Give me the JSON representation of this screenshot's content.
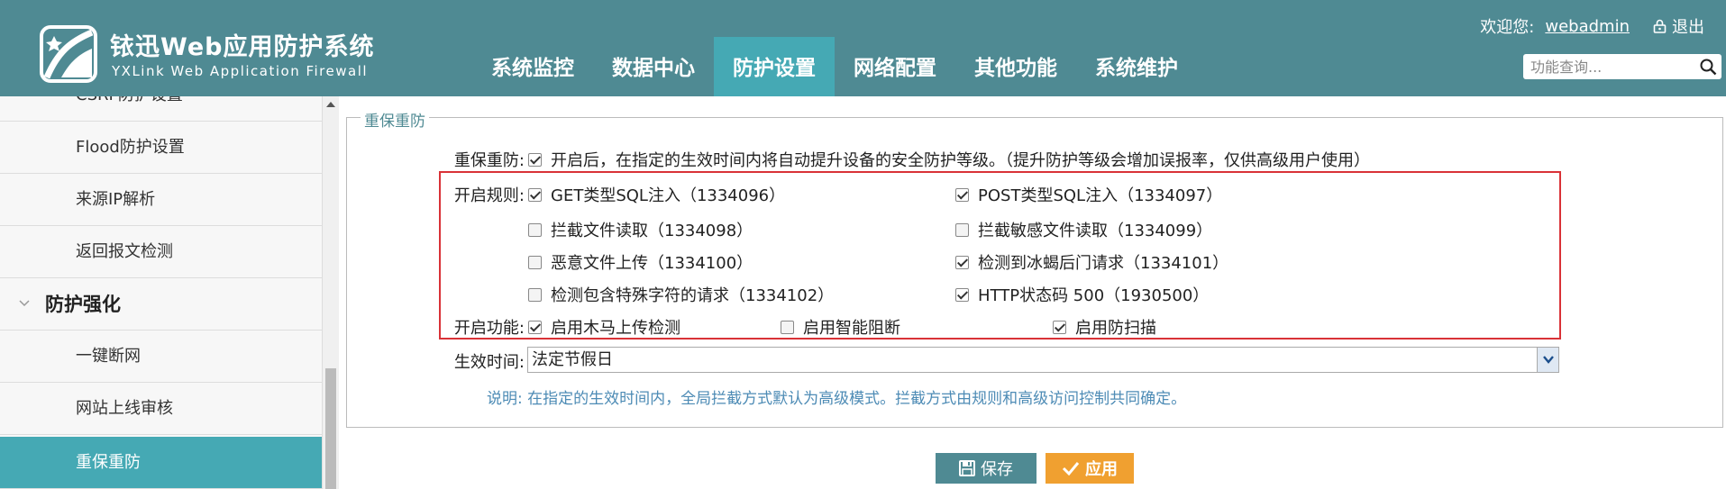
{
  "header": {
    "logo_cn": "铱迅Web应用防护系统",
    "logo_en": "YXLink Web Application Firewall",
    "welcome": "欢迎您:",
    "username": "webadmin",
    "logout": "退出",
    "search_placeholder": "功能查询...",
    "nav": [
      "系统监控",
      "数据中心",
      "防护设置",
      "网络配置",
      "其他功能",
      "系统维护"
    ],
    "active_nav": "防护设置"
  },
  "sidebar": {
    "items": [
      {
        "label": "CSRF防护设置"
      },
      {
        "label": "Flood防护设置"
      },
      {
        "label": "来源IP解析"
      },
      {
        "label": "返回报文检测"
      }
    ],
    "group": {
      "label": "防护强化"
    },
    "group_items": [
      {
        "label": "一键断网"
      },
      {
        "label": "网站上线审核"
      },
      {
        "label": "重保重防",
        "active": true
      }
    ]
  },
  "panel": {
    "legend": "重保重防",
    "enable_label": "重保重防:",
    "enable_text": "开启后，在指定的生效时间内将自动提升设备的安全防护等级。（提升防护等级会增加误报率，仅供高级用户使用）",
    "enable_checked": true,
    "rules_label": "开启规则:",
    "rules": [
      {
        "label": "GET类型SQL注入（1334096）",
        "checked": true
      },
      {
        "label": "POST类型SQL注入（1334097）",
        "checked": true
      },
      {
        "label": "拦截文件读取（1334098）",
        "checked": false
      },
      {
        "label": "拦截敏感文件读取（1334099）",
        "checked": false
      },
      {
        "label": "恶意文件上传（1334100）",
        "checked": false
      },
      {
        "label": "检测到冰蝎后门请求（1334101）",
        "checked": true
      },
      {
        "label": "检测包含特殊字符的请求（1334102）",
        "checked": false
      },
      {
        "label": "HTTP状态码 500（1930500）",
        "checked": true
      }
    ],
    "features_label": "开启功能:",
    "features": [
      {
        "label": "启用木马上传检测",
        "checked": true
      },
      {
        "label": "启用智能阻断",
        "checked": false
      },
      {
        "label": "启用防扫描",
        "checked": true
      }
    ],
    "time_label": "生效时间:",
    "time_value": "法定节假日",
    "note": "说明: 在指定的生效时间内，全局拦截方式默认为高级模式。拦截方式由规则和高级访问控制共同确定。"
  },
  "buttons": {
    "save": "保存",
    "apply": "应用"
  },
  "colors": {
    "header": "#4f8a93",
    "active": "#45a9b4",
    "apply": "#f0a030",
    "highlight": "#d93237"
  }
}
